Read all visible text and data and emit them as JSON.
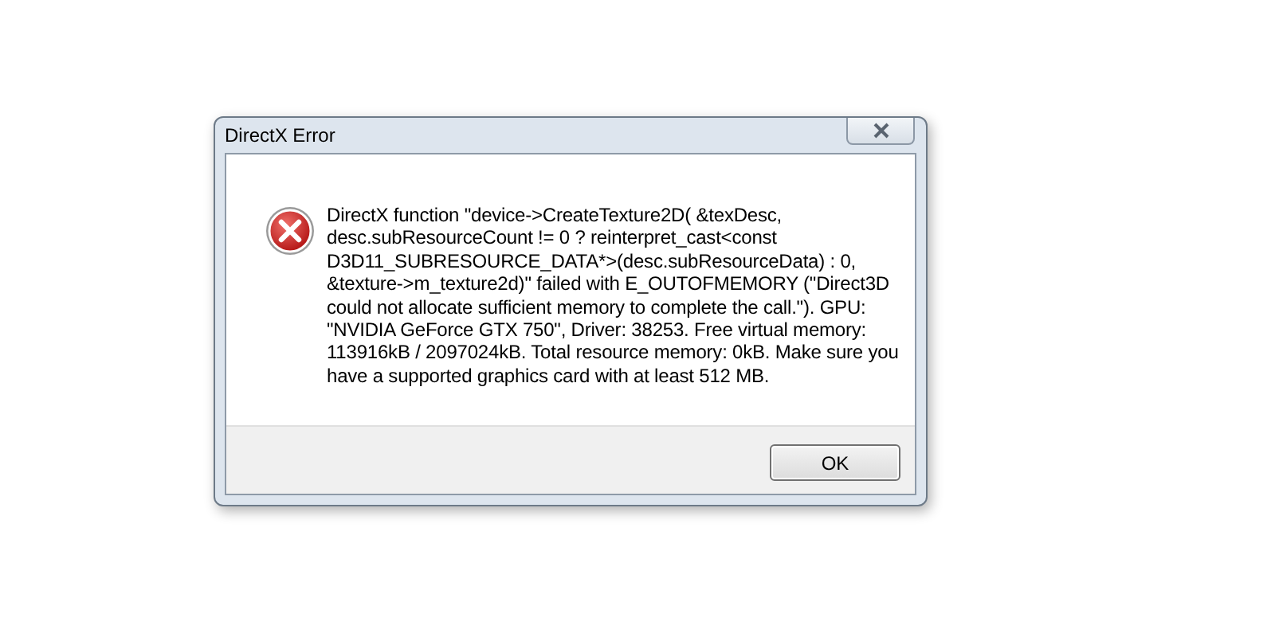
{
  "window": {
    "title": "DirectX Error"
  },
  "message_lines": [
    "DirectX function \"device->CreateTexture2D( &texDesc,",
    "desc.subResourceCount != 0 ? reinterpret_cast<const",
    "D3D11_SUBRESOURCE_DATA*>(desc.subResourceData) : 0,",
    "&texture->m_texture2d)\" failed with E_OUTOFMEMORY (\"Direct3D",
    "could not allocate sufficient memory to complete the call.\"). GPU:",
    "\"NVIDIA GeForce GTX 750\", Driver: 38253. Free virtual memory:",
    "113916kB / 2097024kB. Total resource memory: 0kB. Make sure you",
    "have a supported graphics card with at least 512 MB."
  ],
  "buttons": [
    "OK"
  ]
}
